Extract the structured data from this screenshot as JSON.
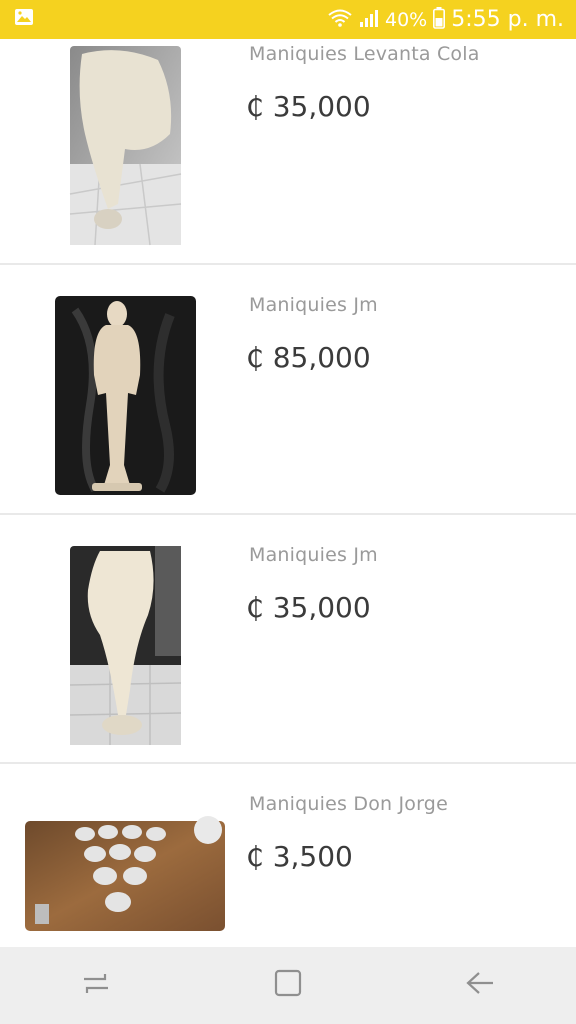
{
  "status_bar": {
    "battery": "40%",
    "time": "5:55 p. m.",
    "background": "#f5d21f"
  },
  "items": [
    {
      "title": "Maniquies Levanta Cola",
      "price": "₵ 35,000",
      "image": "lower-body-mannequin-back"
    },
    {
      "title": "Maniquies Jm",
      "price": "₵ 85,000",
      "image": "full-body-male-mannequin"
    },
    {
      "title": "Maniquies Jm",
      "price": "₵ 35,000",
      "image": "lower-body-mannequin-side"
    },
    {
      "title": "Maniquies Don Jorge",
      "price": "₵ 3,500",
      "image": "bust-forms-on-table"
    }
  ],
  "nav": {
    "recents": "recent-apps-icon",
    "home": "home-icon",
    "back": "back-icon"
  }
}
